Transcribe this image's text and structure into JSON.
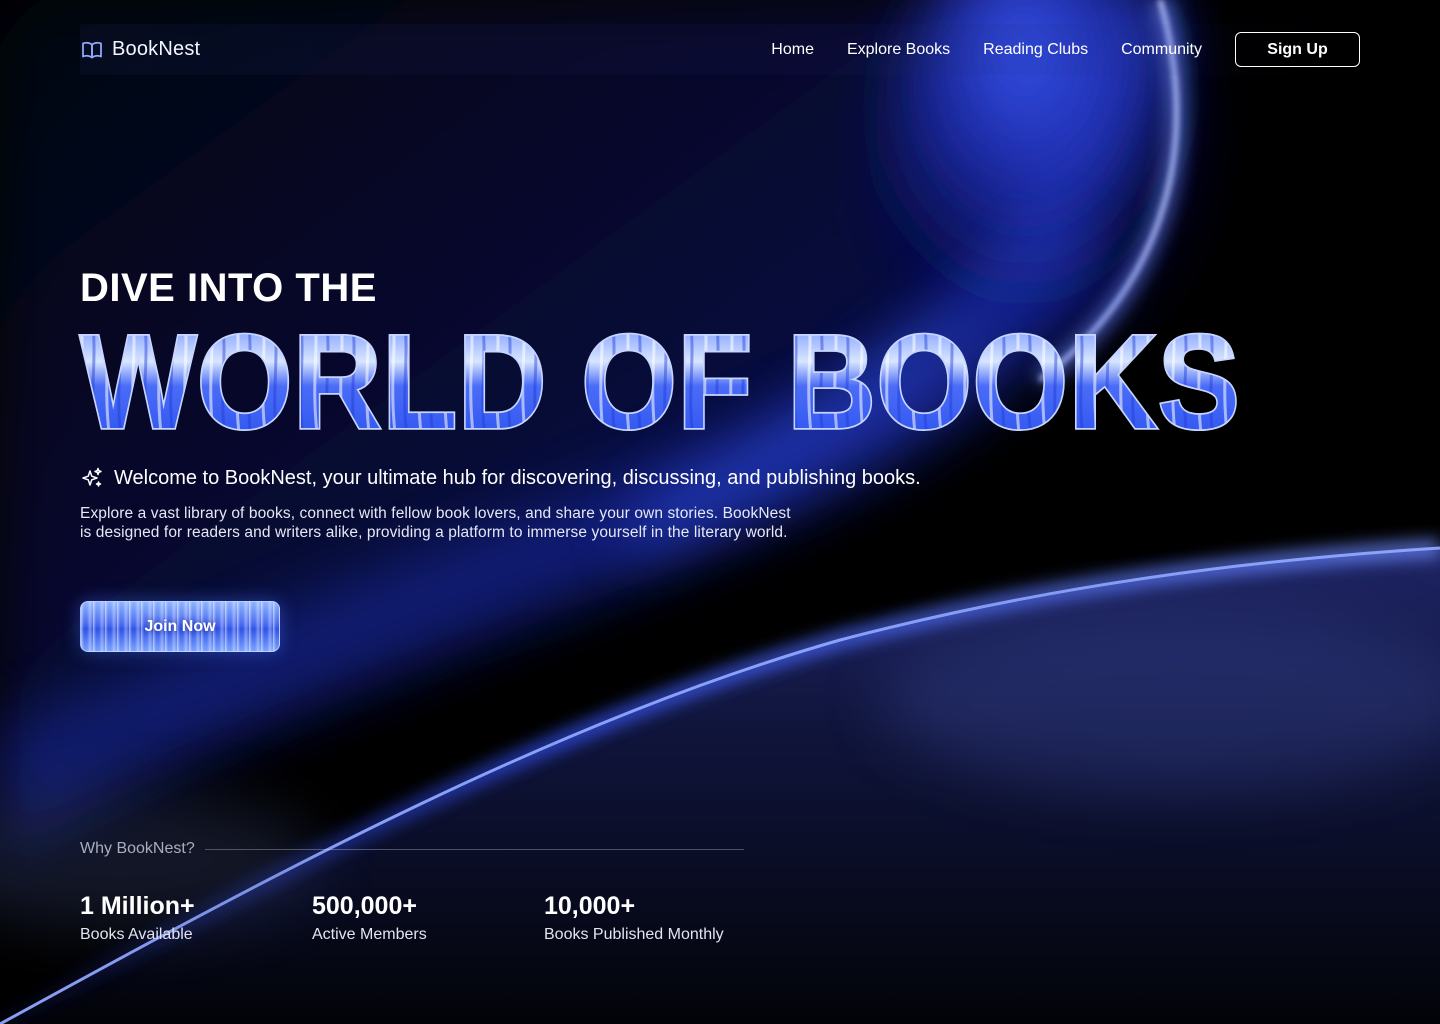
{
  "brand": {
    "name": "BookNest",
    "icon": "open-book-icon"
  },
  "nav": {
    "items": [
      {
        "label": "Home"
      },
      {
        "label": "Explore Books"
      },
      {
        "label": "Reading Clubs"
      },
      {
        "label": "Community"
      }
    ],
    "signup_label": "Sign Up"
  },
  "hero": {
    "kicker": "DIVE INTO THE",
    "title": "WORLD OF BOOKS",
    "tagline": "Welcome to BookNest, your ultimate hub for discovering, discussing, and publishing books.",
    "tagline_icon": "sparkle-icon",
    "description": "Explore a vast library of books, connect with fellow book lovers, and share your own stories. BookNest is designed for readers and writers alike, providing a platform to immerse yourself in the literary world.",
    "cta_label": "Join Now"
  },
  "why": {
    "label": "Why BookNest?",
    "stats": [
      {
        "value": "1 Million+",
        "label": "Books Available"
      },
      {
        "value": "500,000+",
        "label": "Active Members"
      },
      {
        "value": "10,000+",
        "label": "Books Published Monthly"
      }
    ]
  },
  "colors": {
    "background": "#000000",
    "accent_blue": "#3a5cff",
    "chrome_light": "#cfe0ff"
  }
}
